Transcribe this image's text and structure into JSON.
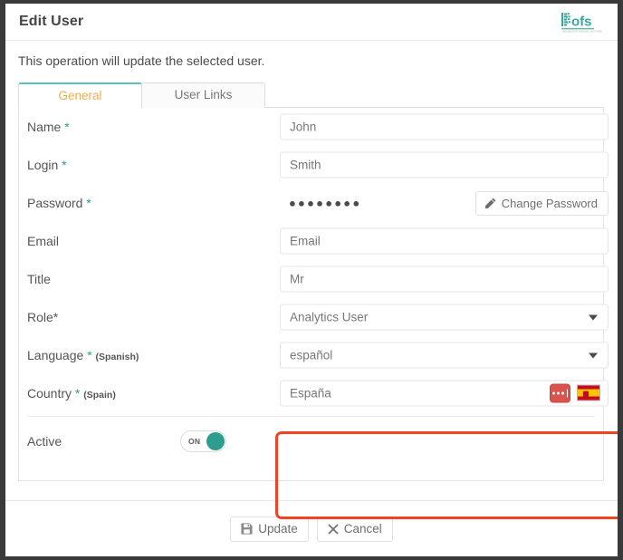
{
  "header": {
    "title": "Edit User",
    "logo_text": "ofs"
  },
  "subtitle": "This operation will update the selected user.",
  "tabs": [
    {
      "label": "General",
      "active": true
    },
    {
      "label": "User Links",
      "active": false
    }
  ],
  "form": {
    "name": {
      "label": "Name",
      "required_mark": "*",
      "value": "John"
    },
    "login": {
      "label": "Login",
      "required_mark": "*",
      "value": "Smith"
    },
    "password": {
      "label": "Password",
      "required_mark": "*",
      "masked_value": "●●●●●●●●",
      "change_button_label": "Change Password",
      "change_button_icon": "pencil-icon"
    },
    "email": {
      "label": "Email",
      "required_mark": "",
      "value": "",
      "placeholder": "Email"
    },
    "title": {
      "label": "Title",
      "required_mark": "",
      "value": "Mr"
    },
    "role": {
      "label": "Role*",
      "required_mark": "",
      "value": "Analytics User",
      "caret_icon": "chevron-down-icon"
    },
    "language": {
      "label": "Language ",
      "required_mark": "*",
      "paren": "(Spanish)",
      "value": "español",
      "caret_icon": "chevron-down-icon"
    },
    "country": {
      "label": "Country ",
      "required_mark": "*",
      "paren": "(Spain)",
      "value": "España",
      "lookup_icon": "ellipsis-icon",
      "flag_icon": "spain-flag-icon"
    },
    "active": {
      "label": "Active",
      "toggle_state": "ON"
    }
  },
  "footer": {
    "update_label": "Update",
    "update_icon": "save-icon",
    "cancel_label": "Cancel",
    "cancel_icon": "close-icon"
  },
  "colors": {
    "accent_teal": "#2c9d8f",
    "tab_active_text": "#f0ad4e",
    "tab_active_border": "#5bc0bd",
    "highlight_red": "#ef4322",
    "lookup_red": "#d9534f"
  }
}
